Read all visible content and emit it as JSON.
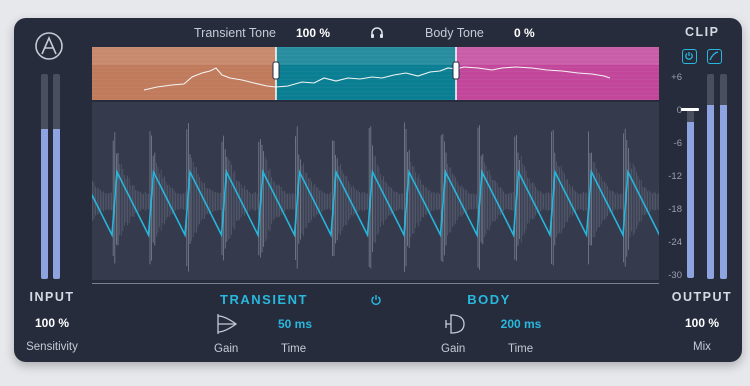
{
  "header": {
    "transient_tone_label": "Transient Tone",
    "transient_tone_value": "100 %",
    "body_tone_label": "Body Tone",
    "body_tone_value": "0 %"
  },
  "clip": {
    "title": "CLIP",
    "scale": [
      "+6",
      "0",
      "-6",
      "-12",
      "-18",
      "-24",
      "-30"
    ]
  },
  "input": {
    "label": "INPUT",
    "sensitivity_value": "100 %",
    "sensitivity_label": "Sensitivity",
    "meter_levels": [
      0.73,
      0.73
    ]
  },
  "output": {
    "label": "OUTPUT",
    "mix_value": "100 %",
    "mix_label": "Mix",
    "meter_levels": [
      0.85,
      0.85
    ]
  },
  "transient": {
    "title": "TRANSIENT",
    "time_value": "50 ms",
    "gain_label": "Gain",
    "time_label": "Time"
  },
  "body": {
    "title": "BODY",
    "time_value": "200 ms",
    "gain_label": "Gain",
    "time_label": "Time"
  },
  "colors": {
    "panel": "#272c3d",
    "accent": "#29b8dd",
    "transient_band": "#c07a5c",
    "mid_band": "#0a7e92",
    "body_band": "#c2479b",
    "meter_fill": "#8ea4e0"
  },
  "icons": {
    "logo": "arkit-logo-icon",
    "headphones": "headphones-icon",
    "power": "power-icon",
    "clip_power": "clip-power-icon",
    "clip_curve": "clip-curve-icon"
  }
}
